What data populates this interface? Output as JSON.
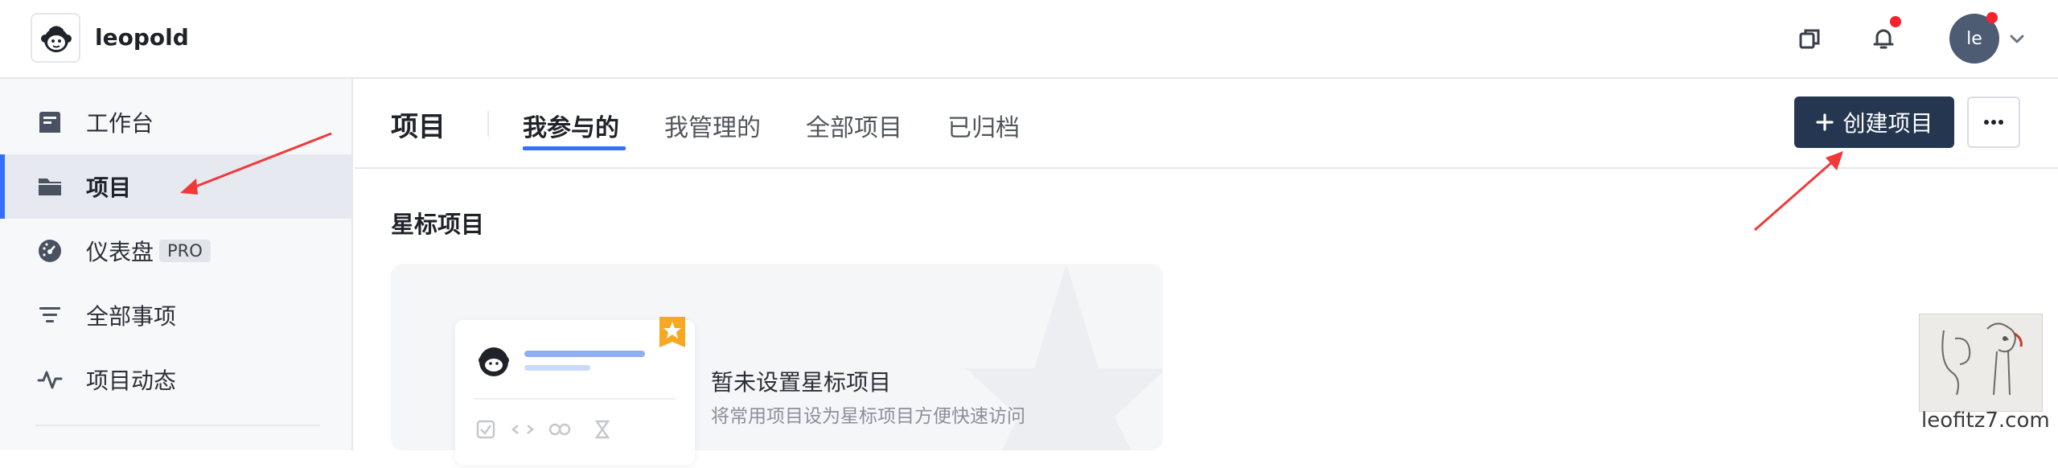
{
  "app": {
    "workspace_name": "leopold"
  },
  "topbar": {
    "icons": [
      "copy-icon",
      "bell-icon",
      "chevron-down-icon"
    ],
    "avatar_initials": "le",
    "notification_color": "#f5222d"
  },
  "sidebar": {
    "items": [
      {
        "label": "工作台",
        "icon": "workbench-icon",
        "active": false
      },
      {
        "label": "项目",
        "icon": "folder-icon",
        "active": true
      },
      {
        "label": "仪表盘",
        "icon": "dashboard-icon",
        "active": false,
        "badge": "PRO"
      },
      {
        "label": "全部事项",
        "icon": "filter-icon",
        "active": false
      },
      {
        "label": "项目动态",
        "icon": "activity-icon",
        "active": false
      }
    ]
  },
  "main": {
    "title": "项目",
    "tabs": [
      {
        "label": "我参与的",
        "active": true
      },
      {
        "label": "我管理的",
        "active": false
      },
      {
        "label": "全部项目",
        "active": false
      },
      {
        "label": "已归档",
        "active": false
      }
    ],
    "create_button_label": "创建项目",
    "section_title": "星标项目",
    "empty_state": {
      "title": "暂未设置星标项目",
      "subtitle": "将常用项目设为星标项目方便快速访问"
    }
  },
  "watermark": {
    "text": "leofitz7.com"
  },
  "colors": {
    "accent": "#3370ff",
    "primary_button": "#253650",
    "annotation_arrow": "#f03a3a",
    "star_badge": "#f7a823"
  }
}
